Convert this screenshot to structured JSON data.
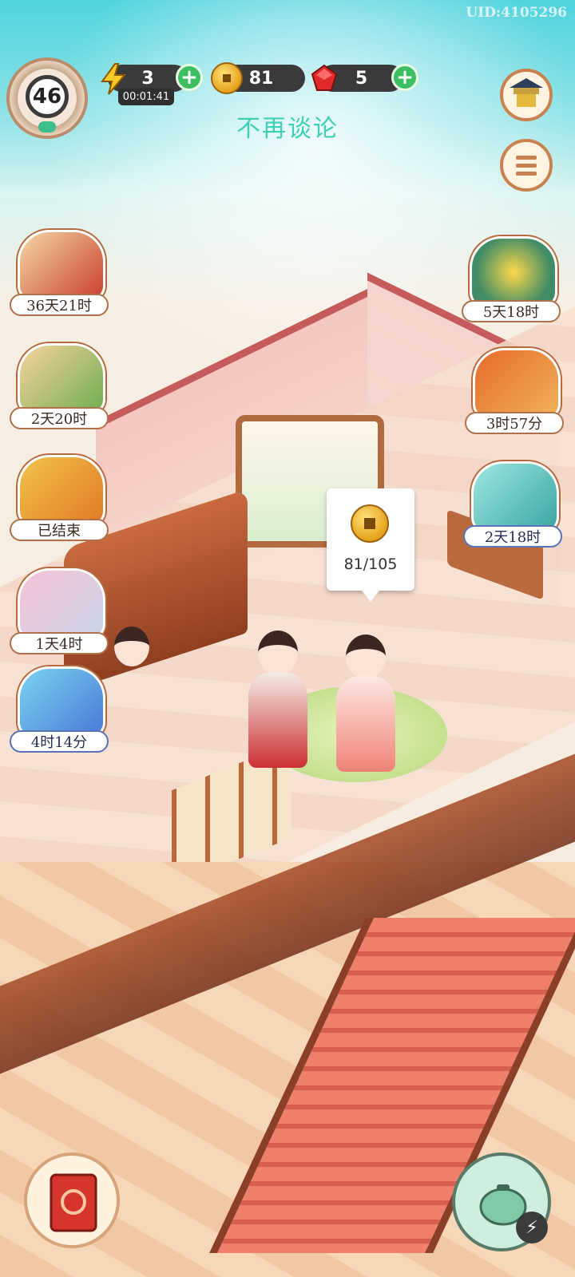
{
  "uid": "UID:4105296",
  "level": "46",
  "energy": {
    "value": "3",
    "timer": "00:01:41",
    "plus": "+"
  },
  "coins": {
    "value": "81"
  },
  "gems": {
    "value": "5",
    "plus": "+"
  },
  "title": "不再谈论",
  "coin_bubble": {
    "text": "81/105"
  },
  "events_left": [
    {
      "name": "book-event",
      "timer": "36天21时"
    },
    {
      "name": "deer-event",
      "timer": "2天20时"
    },
    {
      "name": "wheat-event",
      "timer": "已结束"
    },
    {
      "name": "mouse-event",
      "timer": "1天4时"
    },
    {
      "name": "fish-event",
      "timer": "4时14分"
    }
  ],
  "events_right": [
    {
      "name": "chrysanthemum-event",
      "timer": "5天18时"
    },
    {
      "name": "chest-event",
      "timer": "3时57分"
    },
    {
      "name": "cat-gift-event",
      "timer": "2天18时"
    }
  ],
  "colors": {
    "title": "#3fd0b4",
    "plus": "#3cbf61",
    "pill": "#3a3a3a"
  }
}
